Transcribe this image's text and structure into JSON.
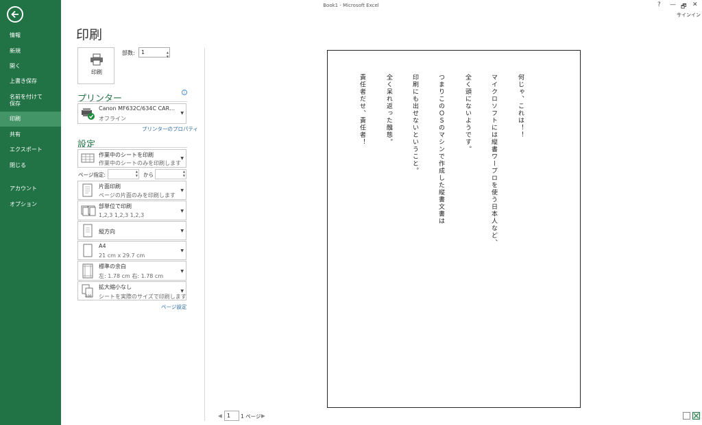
{
  "window": {
    "title": "Book1 - Microsoft Excel",
    "help": "?",
    "minimize": "—",
    "restore": "🗗",
    "close": "✕",
    "signin": "サインイン"
  },
  "sidebar": {
    "items": [
      {
        "label": "情報"
      },
      {
        "label": "新規"
      },
      {
        "label": "開く"
      },
      {
        "label": "上書き保存"
      },
      {
        "label": "名前を付けて"
      },
      {
        "label": "保存"
      },
      {
        "label": "印刷"
      },
      {
        "label": "共有"
      },
      {
        "label": "エクスポート"
      },
      {
        "label": "閉じる"
      },
      {
        "label": "アカウント"
      },
      {
        "label": "オプション"
      }
    ],
    "active_color": "#439467",
    "bg_color": "#217346"
  },
  "print": {
    "title": "印刷",
    "button_label": "印刷",
    "copies_label": "部数:",
    "copies_value": "1"
  },
  "printer": {
    "heading": "プリンター",
    "name": "Canon MF632C/634C CAR…",
    "status": "オフライン",
    "properties_link": "プリンターのプロパティ"
  },
  "settings": {
    "heading": "設定",
    "scope_main": "作業中のシートを印刷",
    "scope_sub": "作業中のシートのみを印刷します",
    "pages_label": "ページ指定:",
    "pages_to": "から",
    "sides_main": "片面印刷",
    "sides_sub": "ページの片面のみを印刷します",
    "collate_main": "部単位で印刷",
    "collate_sub": "1,2,3    1,2,3    1,2,3",
    "orientation_main": "縦方向",
    "paper_main": "A4",
    "paper_sub": "21 cm x 29.7 cm",
    "margins_main": "標準の余白",
    "margins_sub": "左:  1.78 cm    右:  1.78 cm",
    "scaling_main": "拡大縮小なし",
    "scaling_sub": "シートを実際のサイズで印刷します",
    "scaling_icon_text": "100",
    "page_setup_link": "ページ設定"
  },
  "preview": {
    "columns": [
      "何じゃ、これは！！",
      "マイクロソフトには縦書ワープロを使う日本人など、",
      "全く頭にないようです。",
      "つまりこのＯＳのマシンで作成した縦書文書は",
      "印刷にも出せないということ。",
      "全く呆れ返った醜態。",
      "責任者だせ、責任者！"
    ]
  },
  "pager": {
    "current": "1",
    "total": "1 ページ"
  }
}
